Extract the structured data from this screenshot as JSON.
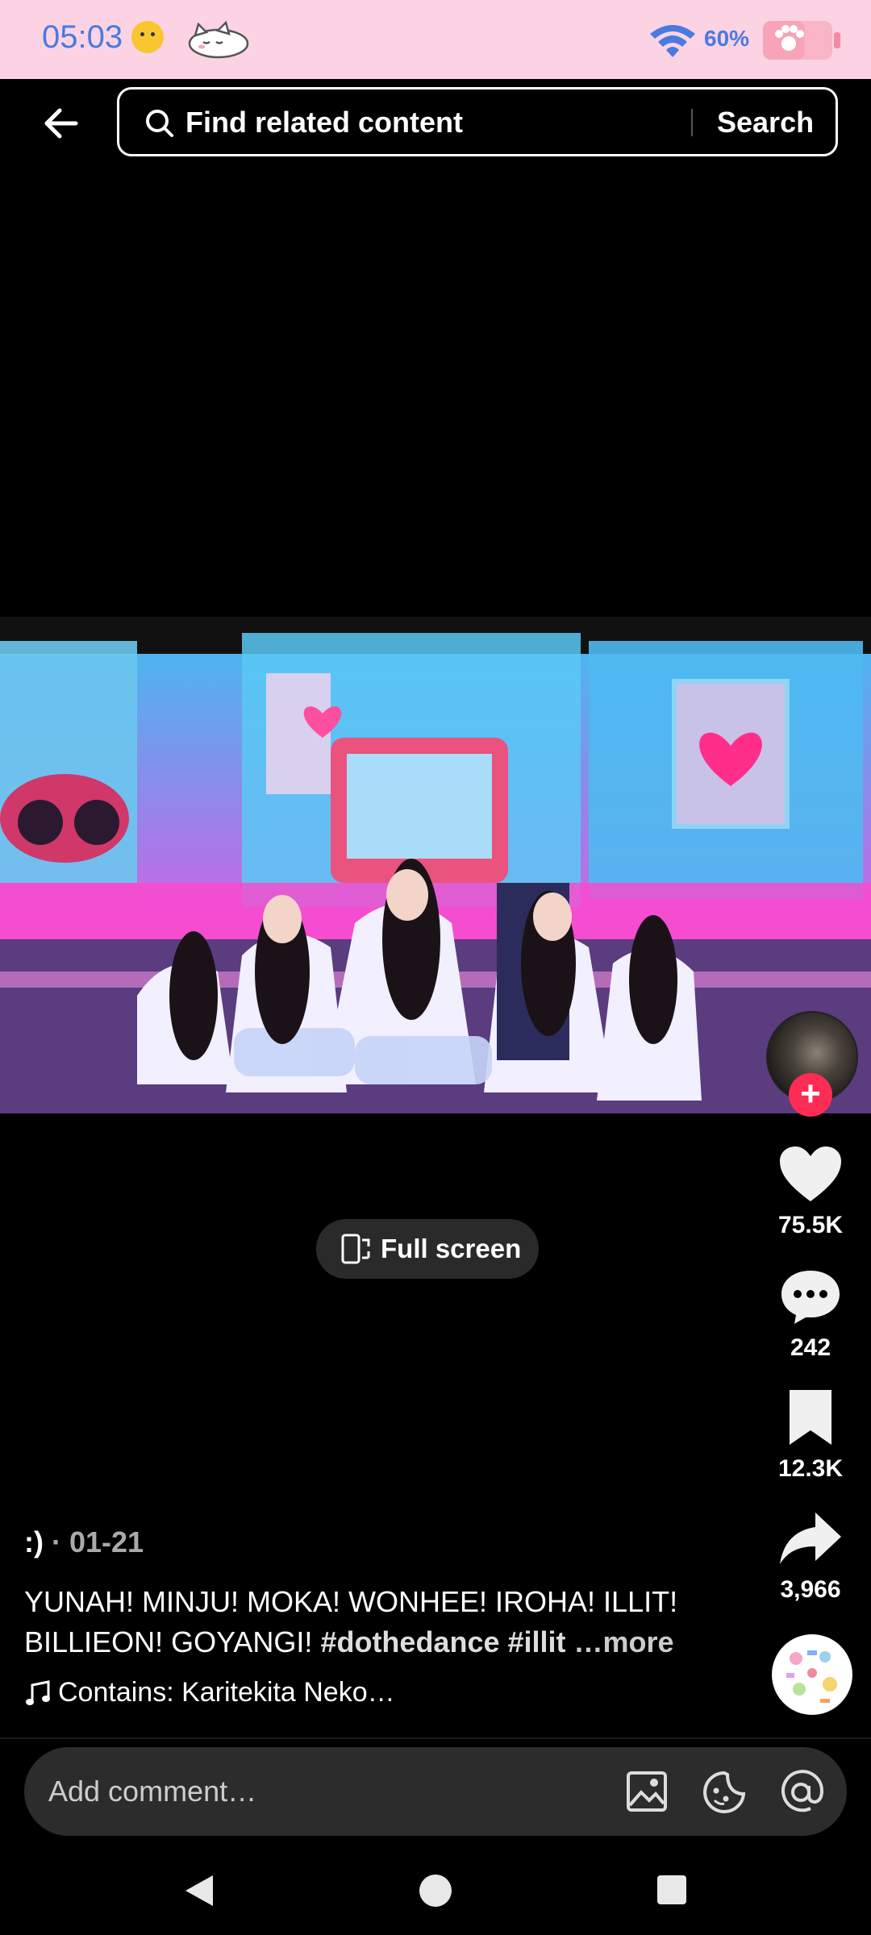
{
  "status_bar": {
    "time": "05:03",
    "battery_percent": "60%",
    "battery_level": 0.6
  },
  "header": {
    "search_placeholder": "Find related content",
    "search_button": "Search"
  },
  "player": {
    "fullscreen_label": "Full screen"
  },
  "actions": {
    "likes": "75.5K",
    "comments": "242",
    "saves": "12.3K",
    "shares": "3,966"
  },
  "post": {
    "author": ":)",
    "separator": " · ",
    "date": "01-21",
    "caption_text": "YUNAH! MINJU! MOKA! WONHEE! IROHA! ILLIT! BILLIEON! GOYANGI! ",
    "hashtag_1": "#dothedance",
    "hashtag_2": "#illit",
    "more": " …more",
    "music": "Contains: Karitekita Neko…"
  },
  "comment": {
    "placeholder": "Add comment…"
  },
  "colors": {
    "status_bar_bg": "#fcd3e3",
    "status_text": "#4a7ae0",
    "follow_accent": "#fe2c55"
  },
  "icons": [
    "wifi-icon",
    "battery-icon",
    "back-arrow-icon",
    "search-icon",
    "fullscreen-icon",
    "heart-icon",
    "comment-icon",
    "bookmark-icon",
    "share-icon",
    "music-note-icon",
    "image-icon",
    "sticker-icon",
    "mention-icon",
    "nav-back-icon",
    "nav-home-icon",
    "nav-recents-icon"
  ]
}
